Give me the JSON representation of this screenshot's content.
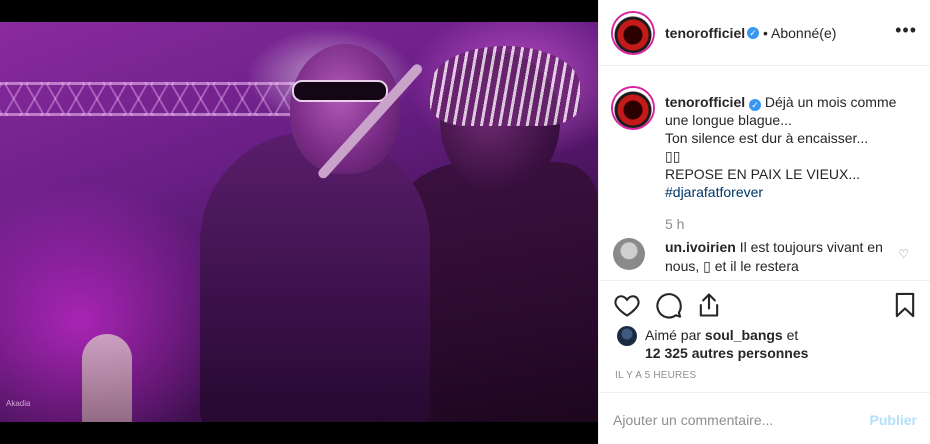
{
  "header": {
    "username": "tenorofficiel",
    "separator_status": "• Abonné(e)",
    "more_icon": "more-horizontal-icon"
  },
  "caption": {
    "username": "tenorofficiel",
    "lines": [
      "Déjà un mois comme une longue blague...",
      "Ton silence est dur à encaisser...",
      "▯▯",
      "REPOSE EN PAIX LE VIEUX..."
    ],
    "hashtag": "#djarafatforever",
    "time": "5 h"
  },
  "comment": {
    "username": "un.ivoirien",
    "text": "Il est toujours vivant en nous, ▯ et il le restera"
  },
  "actions": {
    "like_icon": "heart-icon",
    "comment_icon": "comment-icon",
    "share_icon": "share-icon",
    "save_icon": "bookmark-icon"
  },
  "likes": {
    "prefix": "Aimé par",
    "user": "soul_bangs",
    "suffix": "et",
    "others": "12 325 autres personnes"
  },
  "timestamp": "IL Y A 5 HEURES",
  "comment_box": {
    "placeholder": "Ajouter un commentaire...",
    "post_label": "Publier"
  },
  "photo": {
    "watermark": "Akadia"
  },
  "colors": {
    "verified": "#3897f0",
    "hashtag": "#003569",
    "muted": "#8e8e8e",
    "post_disabled": "#b2dffc"
  }
}
